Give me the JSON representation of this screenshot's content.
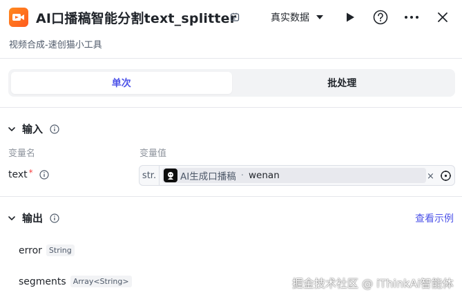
{
  "header": {
    "title": "AI口播稿智能分割text_splitter",
    "subtitle": "视频合成-速创猫小工具",
    "mode_label": "真实数据",
    "icons": [
      "video-app-icon",
      "edit-icon",
      "play-icon",
      "help-icon",
      "more-icon",
      "close-icon"
    ]
  },
  "tabs": [
    {
      "label": "单次",
      "active": true
    },
    {
      "label": "批处理",
      "active": false
    }
  ],
  "input": {
    "section_title": "输入",
    "col_name_label": "变量名",
    "col_value_label": "变量值",
    "fields": [
      {
        "name": "text",
        "required_mark": "*",
        "type_tag": "str.",
        "ref_node": "AI生成口播稿",
        "ref_separator": "·",
        "ref_var": "wenan",
        "clear_glyph": "×"
      }
    ]
  },
  "output": {
    "section_title": "输出",
    "view_example": "查看示例",
    "fields": [
      {
        "name": "error",
        "type": "String"
      },
      {
        "name": "segments",
        "type": "Array<String>"
      }
    ]
  },
  "watermark": "掘金技术社区 @ iThinkAi智能体",
  "colors": {
    "accent": "#4d53e8",
    "app_icon": "#ff6a1f",
    "required": "#f53f3f"
  }
}
